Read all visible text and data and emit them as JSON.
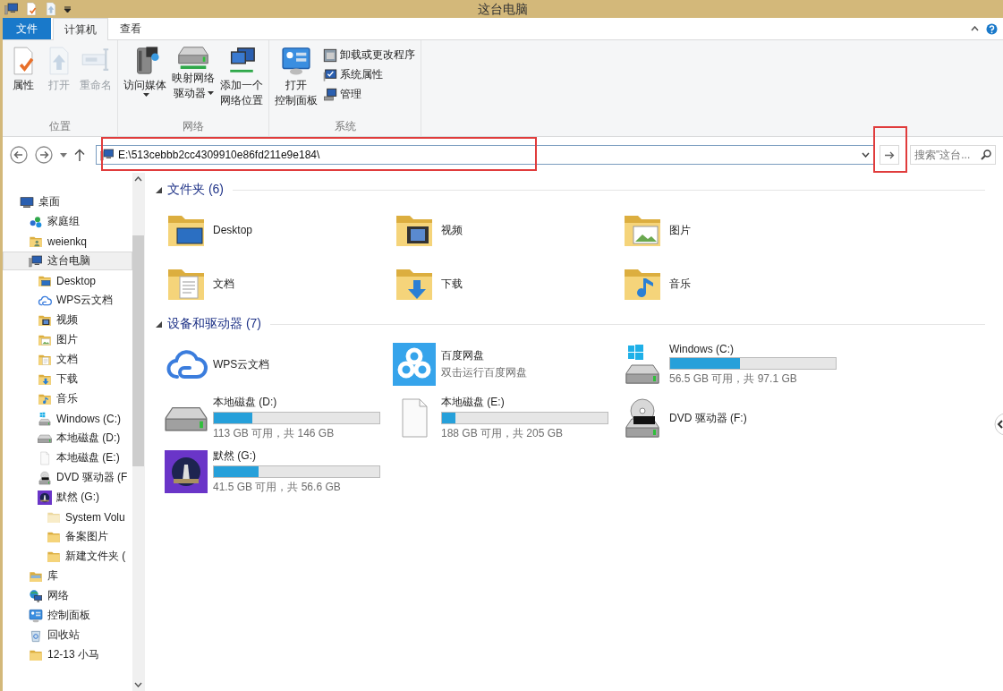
{
  "window": {
    "title": "这台电脑"
  },
  "ribbon_tabs": [
    {
      "label": "文件",
      "kind": "file",
      "selected": false
    },
    {
      "label": "计算机",
      "kind": "tab",
      "selected": true
    },
    {
      "label": "查看",
      "kind": "tab",
      "selected": false
    }
  ],
  "ribbon_groups": [
    {
      "name": "位置",
      "buttons": [
        {
          "kind": "large",
          "lines": [
            "属性"
          ],
          "disabled": false,
          "dropdown": false
        },
        {
          "kind": "large",
          "lines": [
            "打开"
          ],
          "disabled": true,
          "dropdown": false
        },
        {
          "kind": "large",
          "lines": [
            "重命名"
          ],
          "disabled": true,
          "dropdown": false
        }
      ]
    },
    {
      "name": "网络",
      "buttons": [
        {
          "kind": "large",
          "lines": [
            "访问媒体"
          ],
          "disabled": false,
          "dropdown": true
        },
        {
          "kind": "large",
          "lines": [
            "映射网络",
            "驱动器"
          ],
          "disabled": false,
          "dropdown": true
        },
        {
          "kind": "large",
          "lines": [
            "添加一个",
            "网络位置"
          ],
          "disabled": false,
          "dropdown": false
        }
      ]
    },
    {
      "name": "系统",
      "buttons": [
        {
          "kind": "large",
          "lines": [
            "打开",
            "控制面板"
          ],
          "disabled": false,
          "dropdown": false
        },
        {
          "kind": "small",
          "lines": [
            "卸载或更改程序"
          ],
          "disabled": false,
          "dropdown": false
        },
        {
          "kind": "small",
          "lines": [
            "系统属性"
          ],
          "disabled": false,
          "dropdown": false
        },
        {
          "kind": "small",
          "lines": [
            "管理"
          ],
          "disabled": false,
          "dropdown": false
        }
      ]
    }
  ],
  "address_bar": {
    "path": "E:\\513cebbb2cc4309910e86fd211e9e184\\",
    "highlighted": true
  },
  "go_button": {
    "highlighted": true
  },
  "search": {
    "placeholder": "搜索\"这台..."
  },
  "nav_pane": {
    "items": [
      {
        "label": "桌面",
        "kind": "monitor",
        "selected": false,
        "children": [
          {
            "label": "家庭组",
            "kind": "homegroup",
            "selected": false
          },
          {
            "label": "weienkq",
            "kind": "user",
            "selected": false
          },
          {
            "label": "这台电脑",
            "kind": "computer",
            "selected": true,
            "children": [
              {
                "label": "Desktop",
                "kind": "desktop",
                "selected": false
              },
              {
                "label": "WPS云文档",
                "kind": "cloud",
                "selected": false
              },
              {
                "label": "视频",
                "kind": "video",
                "selected": false
              },
              {
                "label": "图片",
                "kind": "pictures",
                "selected": false
              },
              {
                "label": "文档",
                "kind": "docs",
                "selected": false
              },
              {
                "label": "下载",
                "kind": "downloads",
                "selected": false
              },
              {
                "label": "音乐",
                "kind": "music",
                "selected": false
              },
              {
                "label": "Windows (C:)",
                "kind": "windrive",
                "selected": false
              },
              {
                "label": "本地磁盘 (D:)",
                "kind": "drive",
                "selected": false
              },
              {
                "label": "本地磁盘 (E:)",
                "kind": "blank",
                "selected": false
              },
              {
                "label": "DVD 驱动器 (F",
                "kind": "dvd",
                "selected": false
              },
              {
                "label": "默然 (G:)",
                "kind": "applogo",
                "selected": false,
                "children": [
                  {
                    "label": "System Volu",
                    "kind": "folderpale",
                    "selected": false
                  },
                  {
                    "label": "备案图片",
                    "kind": "folder",
                    "selected": false
                  },
                  {
                    "label": "新建文件夹 (",
                    "kind": "folder",
                    "selected": false
                  }
                ]
              }
            ]
          },
          {
            "label": "库",
            "kind": "library",
            "selected": false
          },
          {
            "label": "网络",
            "kind": "network",
            "selected": false
          },
          {
            "label": "控制面板",
            "kind": "cpanel",
            "selected": false
          },
          {
            "label": "回收站",
            "kind": "recycle",
            "selected": false
          },
          {
            "label": "12-13 小马",
            "kind": "folder",
            "selected": false
          }
        ]
      }
    ]
  },
  "content": {
    "groups": [
      {
        "title": "文件夹 (6)",
        "expanded": true,
        "items": [
          {
            "kind": "desktop",
            "name": "Desktop"
          },
          {
            "kind": "video",
            "name": "视频"
          },
          {
            "kind": "pictures",
            "name": "图片"
          },
          {
            "kind": "docs",
            "name": "文档"
          },
          {
            "kind": "downloads",
            "name": "下载"
          },
          {
            "kind": "music",
            "name": "音乐"
          }
        ]
      },
      {
        "title": "设备和驱动器 (7)",
        "expanded": true,
        "items": [
          {
            "kind": "cloud",
            "name": "WPS云文档"
          },
          {
            "kind": "baidu",
            "name": "百度网盘",
            "subtitle": "双击运行百度网盘"
          },
          {
            "kind": "windrive",
            "name": "Windows (C:)",
            "level": 0.42,
            "reading": "56.5 GB 可用，共 97.1 GB"
          },
          {
            "kind": "drive",
            "name": "本地磁盘 (D:)",
            "level": 0.23,
            "reading": "113 GB 可用，共 146 GB"
          },
          {
            "kind": "blank",
            "name": "本地磁盘 (E:)",
            "level": 0.08,
            "reading": "188 GB 可用，共 205 GB"
          },
          {
            "kind": "dvd",
            "name": "DVD 驱动器 (F:)"
          },
          {
            "kind": "applogo",
            "name": "默然 (G:)",
            "level": 0.27,
            "reading": "41.5 GB 可用，共 56.6 GB"
          }
        ]
      }
    ]
  }
}
